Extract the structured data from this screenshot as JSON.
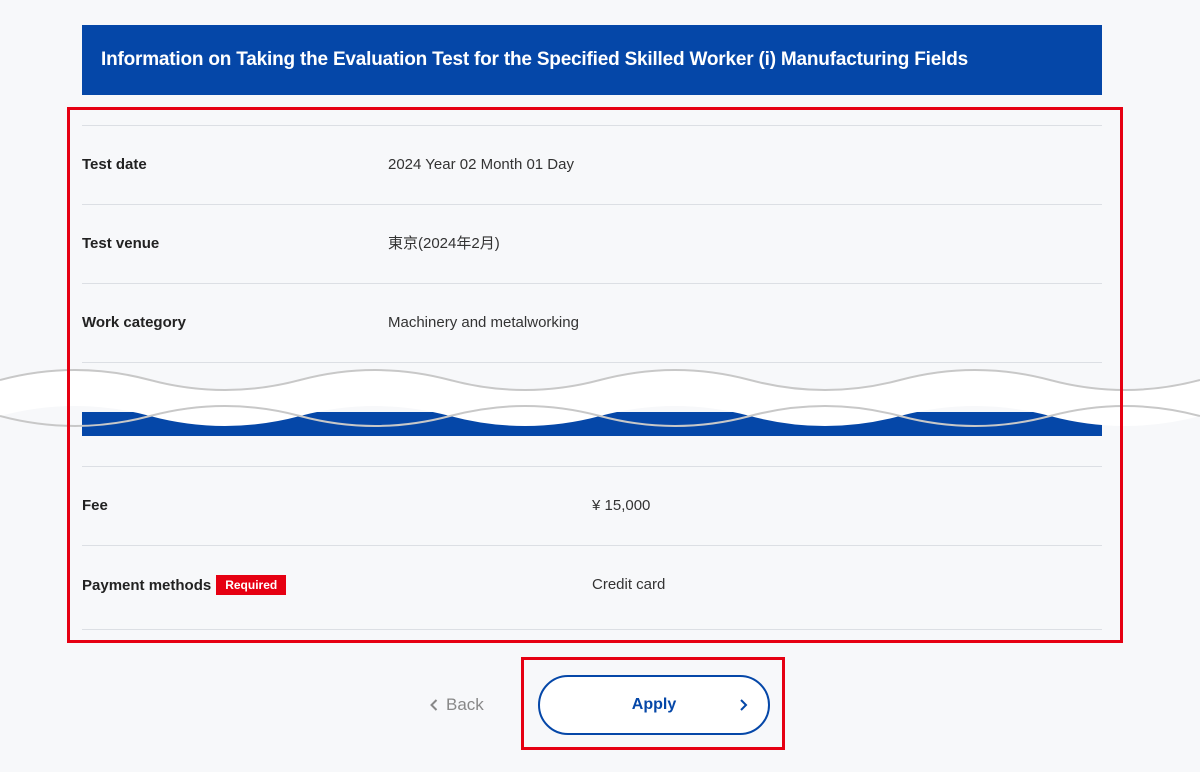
{
  "header": {
    "title": "Information on Taking the Evaluation Test for the Specified Skilled Worker (i) Manufacturing Fields"
  },
  "details": {
    "test_date": {
      "label": "Test date",
      "value": "2024 Year 02 Month 01 Day"
    },
    "test_venue": {
      "label": "Test venue",
      "value": "東京(2024年2月)"
    },
    "work_category": {
      "label": "Work category",
      "value": "Machinery and metalworking"
    },
    "fee": {
      "label": "Fee",
      "value": "¥ 15,000"
    },
    "payment_methods": {
      "label": "Payment methods",
      "badge": "Required",
      "value": "Credit card"
    }
  },
  "actions": {
    "back_label": "Back",
    "apply_label": "Apply"
  },
  "icons": {
    "back": "chevron-left-icon",
    "apply": "chevron-right-icon"
  },
  "colors": {
    "brand_blue": "#0547a8",
    "highlight_red": "#e60012",
    "background": "#f7f8fa"
  }
}
